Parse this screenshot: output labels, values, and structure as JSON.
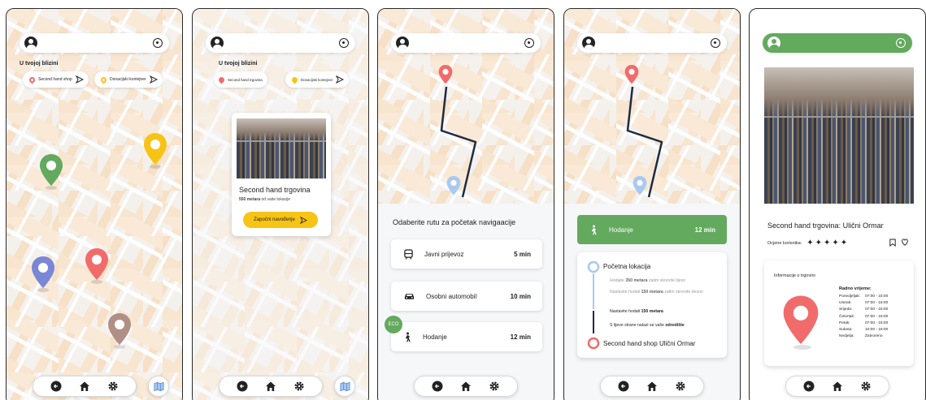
{
  "screens": {
    "map": {
      "nearby_title": "U tvojoj blizini",
      "chip_secondhand": "Second hand shop",
      "chip_donation": "Donacijski kontejner"
    },
    "popup": {
      "nearby_title": "U tvojoj blizini",
      "chip_secondhand": "Second hand trgovina",
      "chip_donation": "Donacijski kontejner",
      "card_title": "Second hand trgovina",
      "distance_bold": "550 metara",
      "distance_rest": "od vaše lokacije",
      "start_button": "Započni navođenje"
    },
    "routes": {
      "title": "Odaberite rutu za početak navigaacije",
      "options": [
        {
          "label": "Javni prijevoz",
          "time": "5 min"
        },
        {
          "label": "Osobni automobil",
          "time": "10 min"
        },
        {
          "label": "Hodanje",
          "time": "12 min"
        }
      ],
      "eco_badge": "ECO"
    },
    "navigation": {
      "mode_label": "Hodanje",
      "mode_time": "12 min",
      "start_label": "Početna lokacija",
      "step1_bold": "350 metara",
      "step1_pre": "Hodajte",
      "step1_post": "zatim skrenite lijevo",
      "step2_pre": "Nastavite hodati",
      "step2_bold": "150 metara",
      "step2_post": "zatim skrenite desno",
      "step3_pre": "Nastavite hodati",
      "step3_bold": "150 metara",
      "step4_pre": "S lijeve strane nalazi se vaše",
      "step4_bold": "odredište",
      "destination": "Second hand shop Ulični Ormar"
    },
    "detail": {
      "title": "Second hand trgovina: Ulični Ormar",
      "rating_label": "Ocjene korisnika:",
      "stars": "✦✦✦✦✦",
      "info_title": "Informacije o trgovini",
      "hours_title": "Radno vrijeme:",
      "hours": [
        {
          "day": "Ponedjeljak:",
          "time": "07:00 - 15:00"
        },
        {
          "day": "Utorak:",
          "time": "07:00 - 15:00"
        },
        {
          "day": "Srijeda:",
          "time": "07:00 - 15:00"
        },
        {
          "day": "Četvrtak:",
          "time": "07:00 - 15:00"
        },
        {
          "day": "Petak:",
          "time": "07:00 - 15:00"
        },
        {
          "day": "Subota:",
          "time": "10:00 - 18:00"
        },
        {
          "day": "Nedjelja:",
          "time": "Zatvoreno"
        }
      ]
    }
  },
  "colors": {
    "green": "#63a95e",
    "yellow": "#f7c416",
    "red": "#f26b6b",
    "blue": "#7a86d6",
    "brown": "#b08f86",
    "light_blue": "#a9c9f0",
    "route": "#1d2a44"
  },
  "icons": [
    "avatar-icon",
    "search-icon",
    "back-icon",
    "home-icon",
    "gear-icon",
    "map-icon",
    "bus-icon",
    "car-icon",
    "walk-icon",
    "send-icon",
    "bookmark-icon",
    "heart-icon"
  ]
}
